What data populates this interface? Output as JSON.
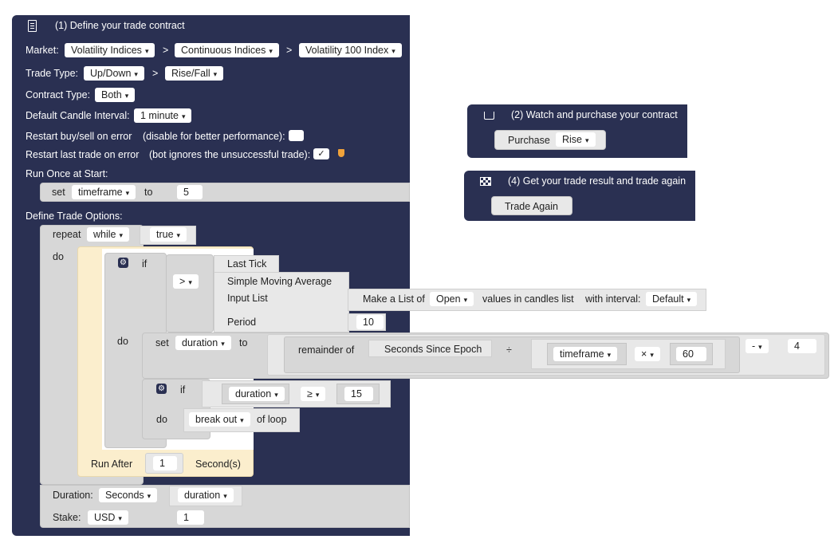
{
  "block1": {
    "title": "(1) Define your trade contract",
    "market_label": "Market:",
    "market": [
      "Volatility Indices",
      "Continuous Indices",
      "Volatility 100 Index"
    ],
    "sep": ">",
    "trade_type_label": "Trade Type:",
    "trade_type": [
      "Up/Down",
      "Rise/Fall"
    ],
    "contract_type_label": "Contract Type:",
    "contract_type": "Both",
    "candle_label": "Default Candle Interval:",
    "candle_value": "1 minute",
    "restart_error_label": "Restart buy/sell on error",
    "restart_error_hint": "(disable for better performance):",
    "restart_last_label": "Restart last trade on error",
    "restart_last_hint": "(bot ignores the unsuccessful trade):",
    "checkmark": "✓",
    "run_once_label": "Run Once at Start:",
    "set": "set",
    "to": "to",
    "timeframe_var": "timeframe",
    "timeframe_value": "5",
    "define_options_label": "Define Trade Options:",
    "repeat": "repeat",
    "while": "while",
    "true_value": "true",
    "do": "do",
    "if": "if",
    "compare_gt": ">",
    "last_tick": "Last Tick",
    "sma": "Simple Moving Average",
    "input_list": "Input List",
    "make_list_of": "Make a List of",
    "open": "Open",
    "values_in_candles": "values in candles list",
    "with_interval": "with interval:",
    "default": "Default",
    "period": "Period",
    "period_value": "10",
    "duration_var": "duration",
    "remainder_of": "remainder of",
    "seconds_since_epoch": "Seconds Since Epoch",
    "divide": "÷",
    "times": "×",
    "sixty": "60",
    "minus": "-",
    "four": "4",
    "gte": "≥",
    "fifteen": "15",
    "break_out": "break out",
    "of_loop": "of loop",
    "run_after": "Run After",
    "run_after_value": "1",
    "seconds_unit": "Second(s)",
    "duration_label": "Duration:",
    "duration_unit": "Seconds",
    "stake_label": "Stake:",
    "currency": "USD",
    "stake_value": "1"
  },
  "block2": {
    "title": "(2) Watch and purchase your contract",
    "purchase": "Purchase",
    "rise": "Rise"
  },
  "block4": {
    "title": "(4) Get your trade result and trade again",
    "trade_again": "Trade Again"
  },
  "icons": {
    "caret": "▾",
    "gear": "⚙"
  },
  "colors": {
    "navy": "#2a3052",
    "block_grey": "#d7d7d7",
    "cream": "#fbeecd",
    "warning": "#f0a23a"
  }
}
